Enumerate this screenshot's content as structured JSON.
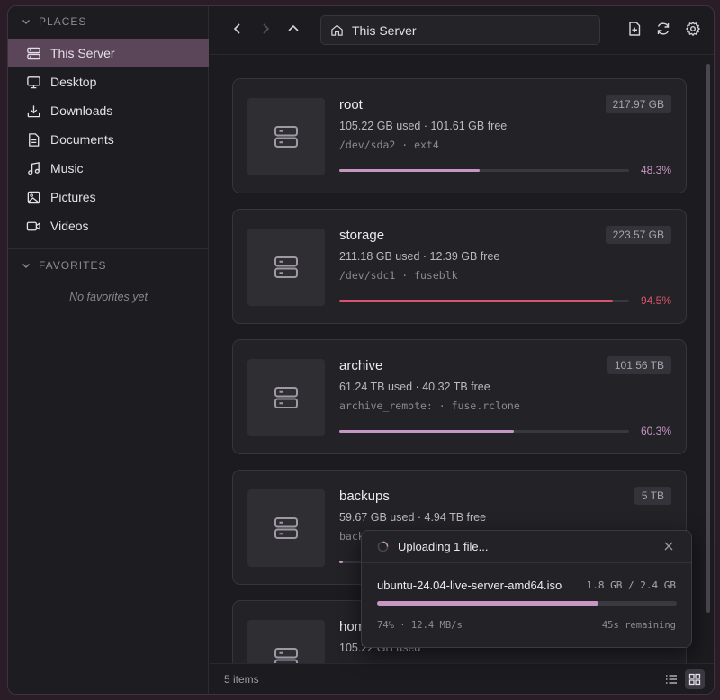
{
  "sidebar": {
    "places_header": "PLACES",
    "favorites_header": "FAVORITES",
    "favorites_empty": "No favorites yet",
    "items": [
      {
        "label": "This Server",
        "icon": "server-icon"
      },
      {
        "label": "Desktop",
        "icon": "monitor-icon"
      },
      {
        "label": "Downloads",
        "icon": "download-icon"
      },
      {
        "label": "Documents",
        "icon": "document-icon"
      },
      {
        "label": "Music",
        "icon": "music-icon"
      },
      {
        "label": "Pictures",
        "icon": "image-icon"
      },
      {
        "label": "Videos",
        "icon": "video-icon"
      }
    ]
  },
  "toolbar": {
    "path": "This Server"
  },
  "drives": [
    {
      "name": "root",
      "usage": "105.22 GB used · 101.61 GB free",
      "device": "/dev/sda2 · ext4",
      "size": "217.97 GB",
      "percent": "48.3%",
      "fraction": 0.483,
      "color": "#c596c4"
    },
    {
      "name": "storage",
      "usage": "211.18 GB used · 12.39 GB free",
      "device": "/dev/sdc1 · fuseblk",
      "size": "223.57 GB",
      "percent": "94.5%",
      "fraction": 0.945,
      "color": "#d9536e"
    },
    {
      "name": "archive",
      "usage": "61.24 TB used · 40.32 TB free",
      "device": "archive_remote: · fuse.rclone",
      "size": "101.56 TB",
      "percent": "60.3%",
      "fraction": 0.603,
      "color": "#c596c4"
    },
    {
      "name": "backups",
      "usage": "59.67 GB used · 4.94 TB free",
      "device": "back",
      "size": "5 TB",
      "percent": "",
      "fraction": 0.012,
      "color": "#c596c4"
    },
    {
      "name": "hom",
      "usage": "105.22 GB used",
      "device": "",
      "size": "",
      "percent": "",
      "fraction": 0,
      "color": "#c596c4"
    }
  ],
  "status": {
    "count": "5 items"
  },
  "upload": {
    "title": "Uploading 1 file...",
    "file": "ubuntu-24.04-live-server-amd64.iso",
    "bytes": "1.8 GB / 2.4 GB",
    "progress": 0.74,
    "speed": "74% · 12.4 MB/s",
    "remaining": "45s remaining"
  },
  "colors": {
    "accent": "#c997c4",
    "danger": "#d9536e"
  }
}
